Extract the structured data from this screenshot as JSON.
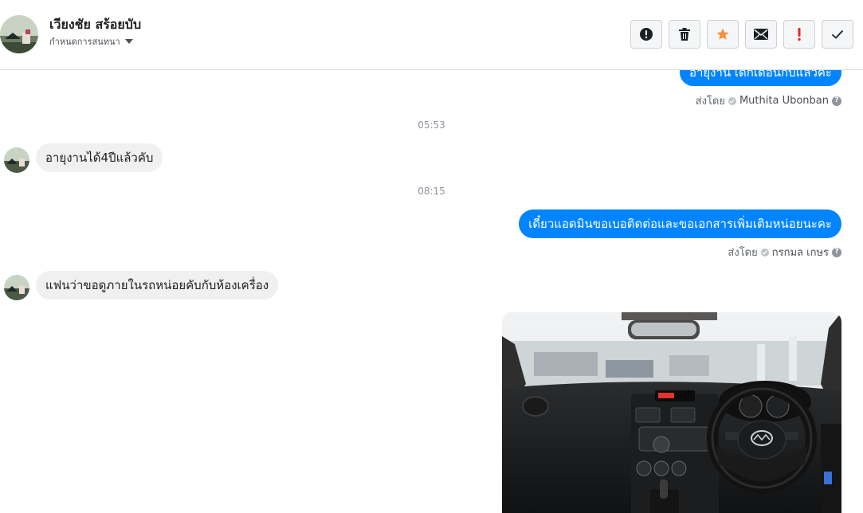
{
  "header": {
    "contact_name": "เวียงชัย สร้อยบับ",
    "settings_label": "กำหนดการสนทนา"
  },
  "actions": [
    {
      "name": "report-button",
      "icon": "alert-circle-icon"
    },
    {
      "name": "delete-button",
      "icon": "trash-icon"
    },
    {
      "name": "star-button",
      "icon": "star-icon",
      "color": "#f7923b"
    },
    {
      "name": "mark-unread-button",
      "icon": "envelope-icon"
    },
    {
      "name": "mark-important-button",
      "icon": "exclamation-icon",
      "color": "#e02b27"
    },
    {
      "name": "mark-done-button",
      "icon": "check-icon"
    }
  ],
  "messages": {
    "m1": {
      "text": "อายุงาน เด็กเดือนกับแล้วคะ",
      "sent_by_label": "ส่งโดย",
      "agent": "Muthita Ubonban"
    },
    "t1": "05:53",
    "m2": {
      "text": "อายุงานได้4ปีแล้วคับ"
    },
    "t2": "08:15",
    "m3": {
      "text": "เดี๋ยวแอดมินขอเบอติดต่อและขอเอกสารเพิ่มเติมหน่อยนะคะ",
      "sent_by_label": "ส่งโดย",
      "agent": "กรกมล เกษร"
    },
    "m4": {
      "text": "แฟนว่าขอดูภายในรถหน่อยคับกับห้องเครื่อง"
    }
  },
  "colors": {
    "outgoing_bubble": "#0084ff",
    "incoming_bubble": "#f1f0f0",
    "accent_star": "#f7923b",
    "accent_important": "#e02b27"
  }
}
